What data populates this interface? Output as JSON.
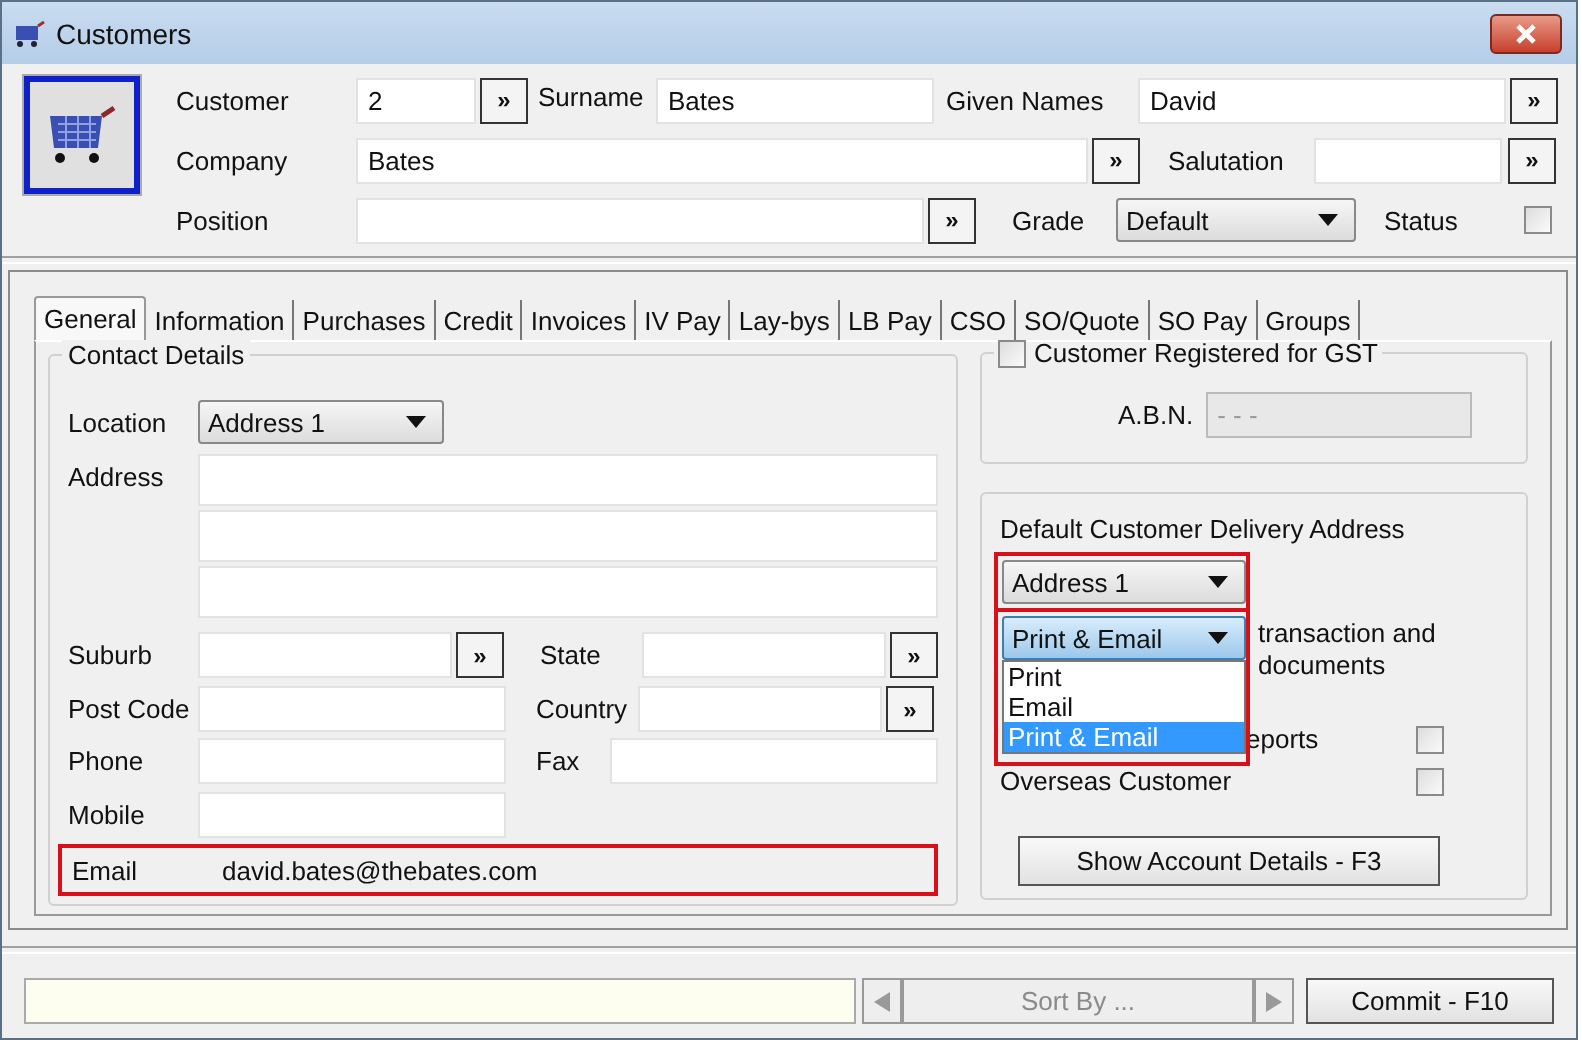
{
  "window": {
    "title": "Customers"
  },
  "header": {
    "customer": {
      "label": "Customer",
      "value": "2"
    },
    "surname": {
      "label": "Surname",
      "value": "Bates"
    },
    "given_names": {
      "label": "Given Names",
      "value": "David"
    },
    "company": {
      "label": "Company",
      "value": "Bates"
    },
    "salutation": {
      "label": "Salutation"
    },
    "position": {
      "label": "Position"
    },
    "grade": {
      "label": "Grade",
      "value": "Default"
    },
    "status": {
      "label": "Status",
      "checked": false
    },
    "lookup_glyph": "»"
  },
  "tabs": [
    {
      "label": "General",
      "selected": true
    },
    {
      "label": "Information",
      "selected": false
    },
    {
      "label": "Purchases",
      "selected": false
    },
    {
      "label": "Credit",
      "selected": false
    },
    {
      "label": "Invoices",
      "selected": false
    },
    {
      "label": "IV Pay",
      "selected": false
    },
    {
      "label": "Lay-bys",
      "selected": false
    },
    {
      "label": "LB Pay",
      "selected": false
    },
    {
      "label": "CSO",
      "selected": false
    },
    {
      "label": "SO/Quote",
      "selected": false
    },
    {
      "label": "SO Pay",
      "selected": false
    },
    {
      "label": "Groups",
      "selected": false
    }
  ],
  "contact_details": {
    "title": "Contact Details",
    "location": {
      "label": "Location",
      "value": "Address 1"
    },
    "address": {
      "label": "Address"
    },
    "suburb": {
      "label": "Suburb"
    },
    "state": {
      "label": "State"
    },
    "post_code": {
      "label": "Post Code"
    },
    "country": {
      "label": "Country"
    },
    "phone": {
      "label": "Phone"
    },
    "fax": {
      "label": "Fax"
    },
    "mobile": {
      "label": "Mobile"
    },
    "email": {
      "label": "Email",
      "value": "david.bates@thebates.com",
      "highlighted": true
    }
  },
  "gst": {
    "label": "Customer Registered for GST",
    "checked": false,
    "abn": {
      "label": "A.B.N.",
      "value": "- - -",
      "disabled": true
    }
  },
  "delivery": {
    "title": "Default Customer Delivery Address",
    "address_select": {
      "value": "Address 1",
      "highlighted": true
    },
    "document_select": {
      "value": "Print & Email",
      "expanded": true,
      "highlighted": true,
      "options": [
        {
          "label": "Print",
          "selected": false
        },
        {
          "label": "Email",
          "selected": false
        },
        {
          "label": "Print & Email",
          "selected": true
        }
      ]
    },
    "document_text": [
      "transaction and",
      "documents"
    ],
    "reports": {
      "label": "eports",
      "checked": false
    },
    "overseas": {
      "label": "Overseas Customer",
      "checked": false
    },
    "account_button": "Show Account Details - F3"
  },
  "footer": {
    "sort": {
      "label": "Sort By ...",
      "disabled": true
    },
    "commit_button": "Commit - F10"
  }
}
